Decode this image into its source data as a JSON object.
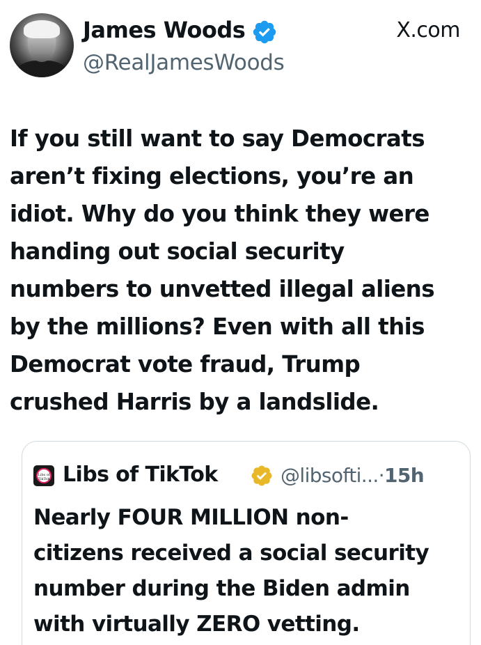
{
  "author": {
    "display_name": "James Woods",
    "handle": "@RealJamesWoods",
    "verified_badge": "verified-blue-check-icon",
    "avatar": "profile-photo"
  },
  "source_label": "X.com",
  "post": {
    "text": "If you still want to say Democrats\naren’t fixing elections, you’re an\nidiot. Why do you think they were\nhanding out social security\nnumbers to unvetted illegal aliens\nby the millions? Even with all this\nDemocrat vote fraud, Trump\ncrushed Harris by a landslide."
  },
  "quoted_post": {
    "display_name": "Libs of TikTok",
    "handle": "@libsofti...",
    "separator": "·",
    "time": "15h",
    "verified_badge": "verified-gold-check-icon",
    "avatar_text": "Libs of TikTok",
    "text": "Nearly FOUR MILLION non-\ncitizens received a social security\nnumber during the Biden admin\nwith virtually ZERO vetting."
  },
  "colors": {
    "text_primary": "#0f1419",
    "text_secondary": "#536471",
    "verified_blue": "#1d9bf0",
    "verified_gold": "#e8b829",
    "border": "#cfd9de"
  }
}
